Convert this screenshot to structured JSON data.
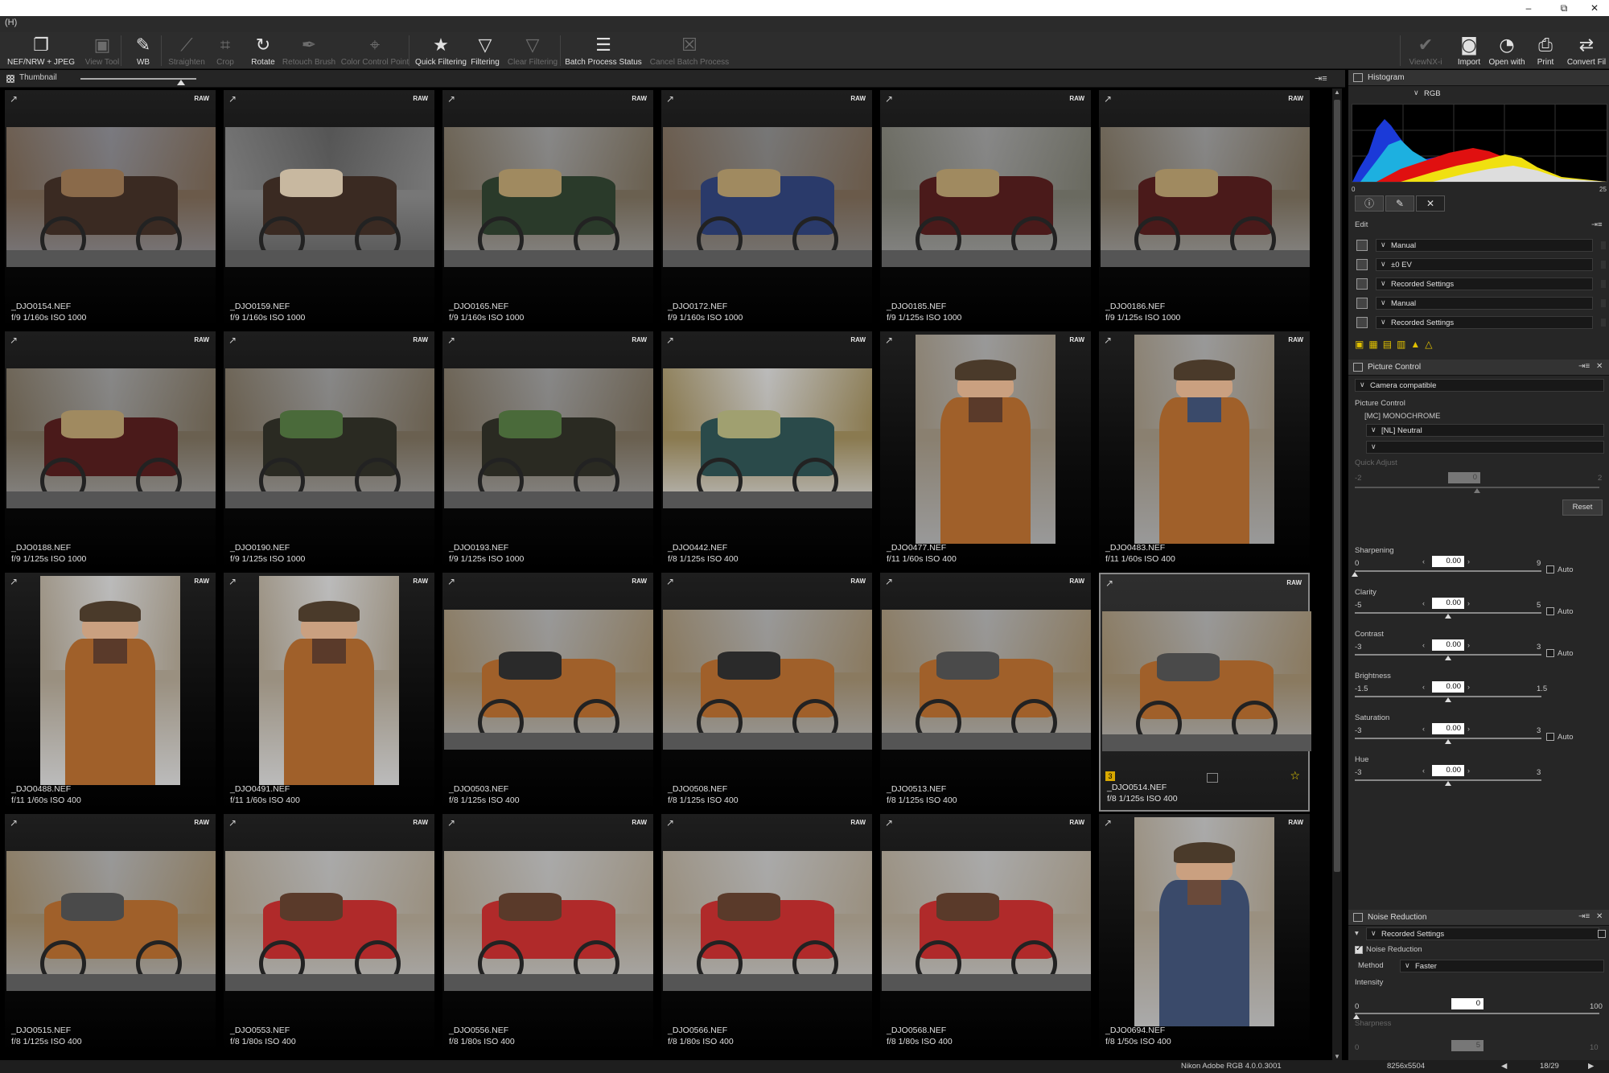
{
  "window": {
    "menu_text": "(H)",
    "minimize": "–",
    "maximize": "⧉",
    "close": "✕"
  },
  "toolbar": {
    "left": [
      {
        "label": "NEF/NRW + JPEG",
        "icon": "file-type-icon",
        "glyph": "❐",
        "enabled": true
      },
      {
        "label": "View Tool",
        "icon": "view-tool-icon",
        "glyph": "▣",
        "enabled": false
      },
      {
        "label": "WB",
        "icon": "eyedropper-icon",
        "glyph": "✎",
        "enabled": true
      },
      {
        "label": "Straighten",
        "icon": "straighten-icon",
        "glyph": "⟋",
        "enabled": false
      },
      {
        "label": "Crop",
        "icon": "crop-icon",
        "glyph": "⌗",
        "enabled": false
      },
      {
        "label": "Rotate",
        "icon": "rotate-icon",
        "glyph": "↻",
        "enabled": true
      },
      {
        "label": "Retouch Brush",
        "icon": "brush-icon",
        "glyph": "✒",
        "enabled": false
      },
      {
        "label": "Color Control Point",
        "icon": "control-point-icon",
        "glyph": "⌖",
        "enabled": false
      },
      {
        "label": "Quick Filtering",
        "icon": "star-icon",
        "glyph": "★",
        "enabled": true
      },
      {
        "label": "Filtering",
        "icon": "filter-icon",
        "glyph": "▽",
        "enabled": true
      },
      {
        "label": "Clear Filtering",
        "icon": "clear-filter-icon",
        "glyph": "▽",
        "enabled": false
      },
      {
        "label": "Batch Process Status",
        "icon": "batch-status-icon",
        "glyph": "☰",
        "enabled": true
      },
      {
        "label": "Cancel Batch Process",
        "icon": "cancel-batch-icon",
        "glyph": "☒",
        "enabled": false
      }
    ],
    "right": [
      {
        "label": "ViewNX-i",
        "icon": "viewnx-icon",
        "glyph": "✔",
        "enabled": false
      },
      {
        "label": "Import",
        "icon": "import-icon",
        "glyph": "◙",
        "enabled": true
      },
      {
        "label": "Open with",
        "icon": "open-with-icon",
        "glyph": "◔",
        "enabled": true
      },
      {
        "label": "Print",
        "icon": "print-icon",
        "glyph": "⎙",
        "enabled": true
      },
      {
        "label": "Convert Fil",
        "icon": "convert-icon",
        "glyph": "⇄",
        "enabled": true
      }
    ]
  },
  "thumbnail_panel": {
    "title": "Thumbnail",
    "collapse": "⇥≡"
  },
  "thumbnails": [
    {
      "file": "_DJO0154.NEF",
      "exif": "f/9 1/160s ISO 1000",
      "orient": "land",
      "palette": [
        "#6b5a4a",
        "#3a2a22",
        "#8a6a4a",
        "#7a7a80"
      ]
    },
    {
      "file": "_DJO0159.NEF",
      "exif": "f/9 1/160s ISO 1000",
      "orient": "land",
      "palette": [
        "#777",
        "#3a2a22",
        "#c8b8a0",
        "#555"
      ]
    },
    {
      "file": "_DJO0165.NEF",
      "exif": "f/9 1/160s ISO 1000",
      "orient": "land",
      "palette": [
        "#6a6050",
        "#2a3a2a",
        "#a08a60",
        "#888"
      ]
    },
    {
      "file": "_DJO0172.NEF",
      "exif": "f/9 1/160s ISO 1000",
      "orient": "land",
      "palette": [
        "#6a5a4a",
        "#2a3a6a",
        "#a08a60",
        "#777"
      ]
    },
    {
      "file": "_DJO0185.NEF",
      "exif": "f/9 1/125s ISO 1000",
      "orient": "land",
      "palette": [
        "#6a6a60",
        "#4a1a1a",
        "#a08a60",
        "#888"
      ]
    },
    {
      "file": "_DJO0186.NEF",
      "exif": "f/9 1/125s ISO 1000",
      "orient": "land",
      "palette": [
        "#6a6050",
        "#4a1a1a",
        "#a08a60",
        "#888"
      ]
    },
    {
      "file": "_DJO0188.NEF",
      "exif": "f/9 1/125s ISO 1000",
      "orient": "land",
      "palette": [
        "#6a6050",
        "#4a1a1a",
        "#a08a60",
        "#888"
      ]
    },
    {
      "file": "_DJO0190.NEF",
      "exif": "f/9 1/125s ISO 1000",
      "orient": "land",
      "palette": [
        "#6a6050",
        "#2a2a22",
        "#4a6a3a",
        "#888"
      ]
    },
    {
      "file": "_DJO0193.NEF",
      "exif": "f/9 1/125s ISO 1000",
      "orient": "land",
      "palette": [
        "#6a6050",
        "#2a2a22",
        "#4a6a3a",
        "#888"
      ]
    },
    {
      "file": "_DJO0442.NEF",
      "exif": "f/8 1/125s ISO 400",
      "orient": "land",
      "palette": [
        "#8a7a50",
        "#2a4a4a",
        "#a0a070",
        "#bbb"
      ]
    },
    {
      "file": "_DJO0477.NEF",
      "exif": "f/11 1/60s ISO 400",
      "orient": "port",
      "palette": [
        "#8a8070",
        "#a0602a",
        "#5a3a2a",
        "#999"
      ]
    },
    {
      "file": "_DJO0483.NEF",
      "exif": "f/11 1/60s ISO 400",
      "orient": "port",
      "palette": [
        "#8a8070",
        "#a0602a",
        "#3a4a6a",
        "#999"
      ]
    },
    {
      "file": "_DJO0488.NEF",
      "exif": "f/11 1/60s ISO 400",
      "orient": "port",
      "palette": [
        "#9a9080",
        "#a0602a",
        "#5a3a2a",
        "#bbb"
      ]
    },
    {
      "file": "_DJO0491.NEF",
      "exif": "f/11 1/60s ISO 400",
      "orient": "port",
      "palette": [
        "#9a9080",
        "#a0602a",
        "#5a3a2a",
        "#bbb"
      ]
    },
    {
      "file": "_DJO0503.NEF",
      "exif": "f/8 1/125s ISO 400",
      "orient": "land",
      "palette": [
        "#8a7a60",
        "#a0602a",
        "#2a2a2a",
        "#999"
      ]
    },
    {
      "file": "_DJO0508.NEF",
      "exif": "f/8 1/125s ISO 400",
      "orient": "land",
      "palette": [
        "#8a7a60",
        "#a0602a",
        "#2a2a2a",
        "#999"
      ]
    },
    {
      "file": "_DJO0513.NEF",
      "exif": "f/8 1/125s ISO 400",
      "orient": "land",
      "palette": [
        "#8a7a60",
        "#a0602a",
        "#4a4a4a",
        "#999"
      ]
    },
    {
      "file": "_DJO0514.NEF",
      "exif": "f/8 1/125s ISO 400",
      "orient": "land",
      "palette": [
        "#8a7a60",
        "#a0602a",
        "#4a4a4a",
        "#999"
      ],
      "selected": true,
      "label": "3",
      "starred": true
    },
    {
      "file": "_DJO0515.NEF",
      "exif": "f/8 1/125s ISO 400",
      "orient": "land",
      "palette": [
        "#8a7a60",
        "#a0602a",
        "#4a4a4a",
        "#999"
      ]
    },
    {
      "file": "_DJO0553.NEF",
      "exif": "f/8 1/80s ISO 400",
      "orient": "land",
      "palette": [
        "#9a9080",
        "#b02a2a",
        "#5a3a2a",
        "#aaa"
      ]
    },
    {
      "file": "_DJO0556.NEF",
      "exif": "f/8 1/80s ISO 400",
      "orient": "land",
      "palette": [
        "#9a9080",
        "#b02a2a",
        "#5a3a2a",
        "#aaa"
      ]
    },
    {
      "file": "_DJO0566.NEF",
      "exif": "f/8 1/80s ISO 400",
      "orient": "land",
      "palette": [
        "#9a9080",
        "#b02a2a",
        "#5a3a2a",
        "#aaa"
      ]
    },
    {
      "file": "_DJO0568.NEF",
      "exif": "f/8 1/80s ISO 400",
      "orient": "land",
      "palette": [
        "#9a9080",
        "#b02a2a",
        "#5a3a2a",
        "#aaa"
      ]
    },
    {
      "file": "_DJO0694.NEF",
      "exif": "f/8 1/50s ISO 400",
      "orient": "port",
      "palette": [
        "#9a9080",
        "#3a4a6a",
        "#6a4a3a",
        "#aaa"
      ]
    }
  ],
  "thumb_badge": "RAW",
  "histogram": {
    "title": "Histogram",
    "channel": "RGB",
    "min_label": "0",
    "max_label": "25"
  },
  "edit": {
    "title": "Edit",
    "rows": [
      {
        "icon": "settings-icon",
        "value": "Manual"
      },
      {
        "icon": "exposure-icon",
        "value": "±0 EV"
      },
      {
        "icon": "wb-icon",
        "value": "Recorded Settings"
      },
      {
        "icon": "tone-icon",
        "value": "Manual"
      },
      {
        "icon": "picture-style-icon",
        "value": "Recorded Settings"
      }
    ]
  },
  "picture_control": {
    "title": "Picture Control",
    "mode": "Camera compatible",
    "label": "Picture Control",
    "current": "[MC] MONOCHROME",
    "selected": "[NL] Neutral",
    "quick_adjust": {
      "label": "Quick Adjust",
      "min": "-2",
      "max": "2",
      "value": "0"
    },
    "reset": "Reset",
    "sliders": [
      {
        "label": "Sharpening",
        "min": "0",
        "max": "9",
        "value": "0.00",
        "auto": true,
        "fraction": 0.0
      },
      {
        "label": "Clarity",
        "min": "-5",
        "max": "5",
        "value": "0.00",
        "auto": true,
        "fraction": 0.5
      },
      {
        "label": "Contrast",
        "min": "-3",
        "max": "3",
        "value": "0.00",
        "auto": true,
        "fraction": 0.5
      },
      {
        "label": "Brightness",
        "min": "-1.5",
        "max": "1.5",
        "value": "0.00",
        "auto": false,
        "fraction": 0.5
      },
      {
        "label": "Saturation",
        "min": "-3",
        "max": "3",
        "value": "0.00",
        "auto": true,
        "fraction": 0.5
      },
      {
        "label": "Hue",
        "min": "-3",
        "max": "3",
        "value": "0.00",
        "auto": false,
        "fraction": 0.5
      }
    ],
    "auto_label": "Auto"
  },
  "noise_reduction": {
    "title": "Noise Reduction",
    "preset": "Recorded Settings",
    "enable_label": "Noise Reduction",
    "method_label": "Method",
    "method": "Faster",
    "intensity": {
      "label": "Intensity",
      "min": "0",
      "max": "100",
      "value": "0"
    },
    "sharpness": {
      "label": "Sharpness",
      "min": "0",
      "max": "10",
      "value": "5"
    }
  },
  "status": {
    "profile": "Nikon Adobe RGB 4.0.0.3001",
    "dimensions": "8256x5504",
    "position": "18/29",
    "prev": "◀",
    "next": "▶"
  }
}
